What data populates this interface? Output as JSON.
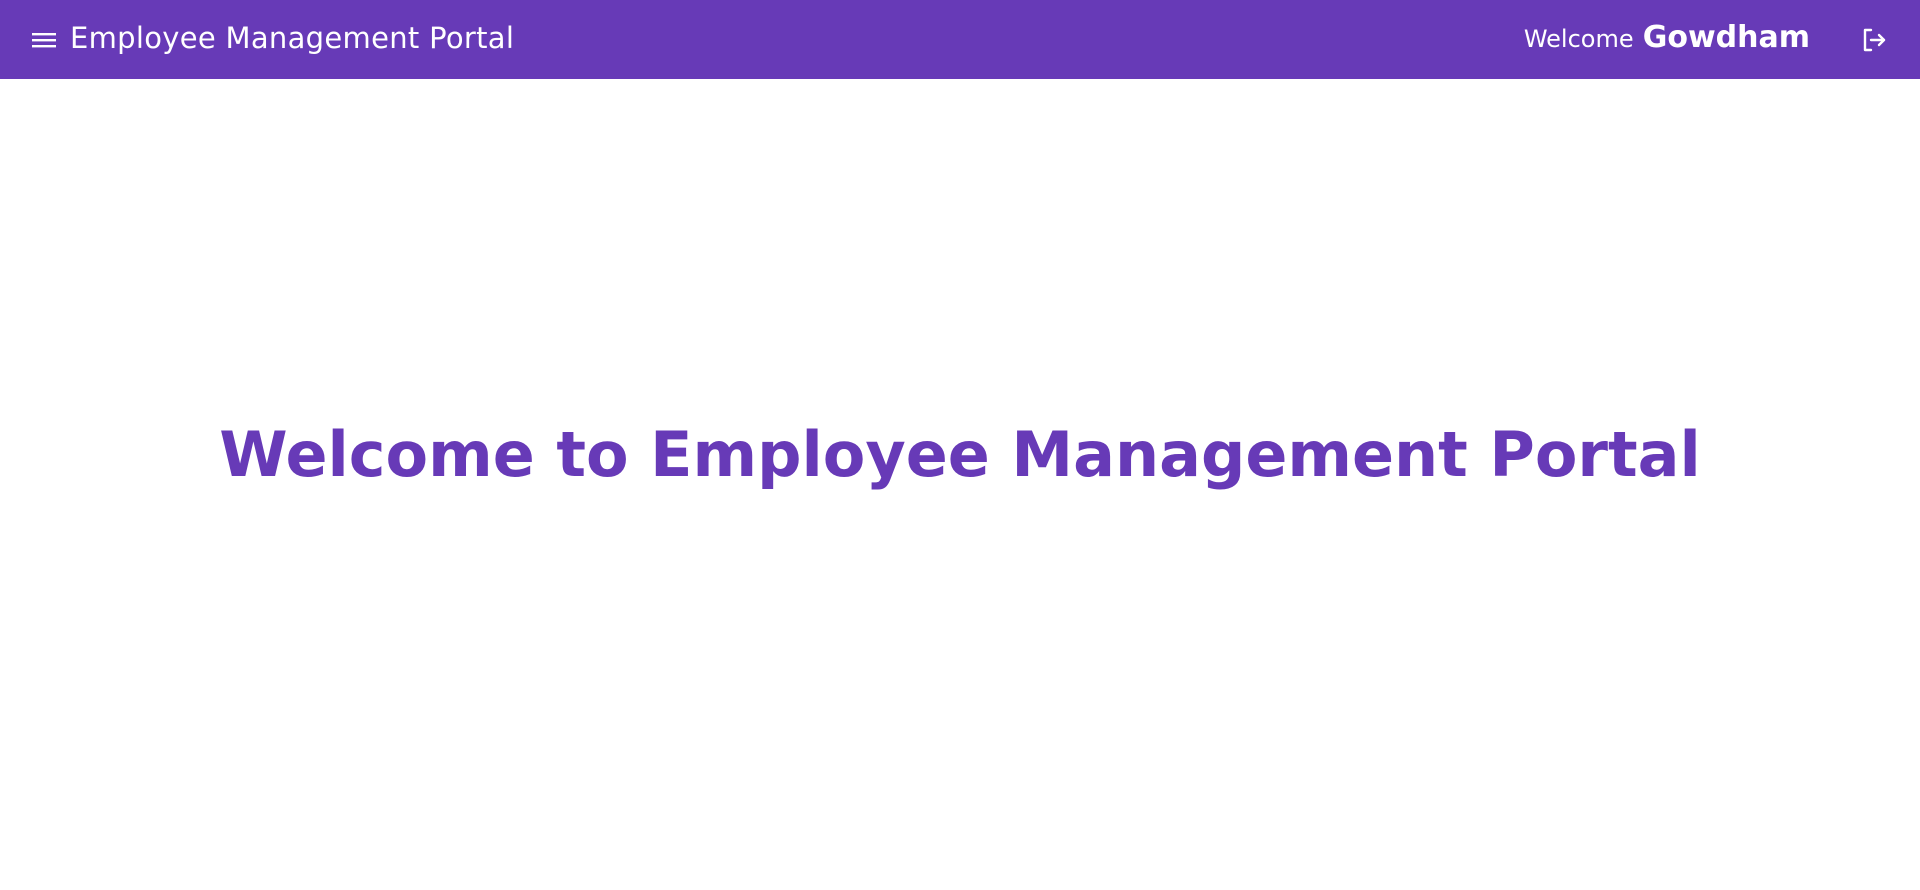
{
  "header": {
    "menu_icon": "menu-icon",
    "title": "Employee Management Portal",
    "welcome_label": "Welcome",
    "username": "Gowdham",
    "logout_icon": "logout-icon"
  },
  "main": {
    "heading": "Welcome to Employee Management Portal"
  },
  "colors": {
    "primary": "#673ab7",
    "header_text": "#ffffff",
    "background": "#ffffff"
  }
}
